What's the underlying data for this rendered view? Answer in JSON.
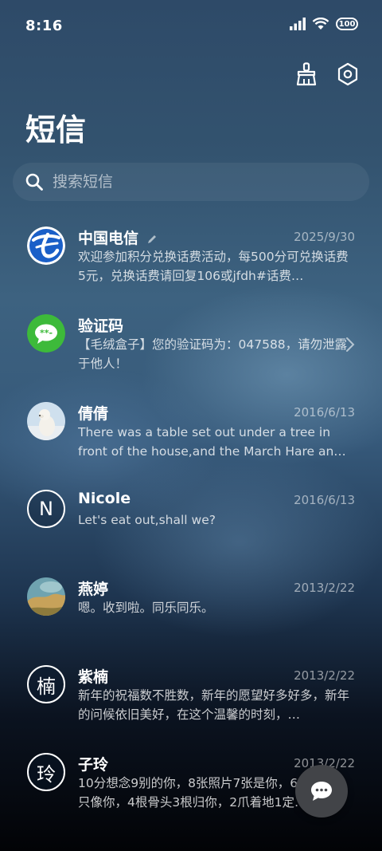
{
  "status_bar": {
    "time": "8:16",
    "battery": "100"
  },
  "header": {
    "title": "短信"
  },
  "search": {
    "placeholder": "搜索短信"
  },
  "conversations": [
    {
      "name": "中国电信",
      "date": "2025/9/30",
      "preview": "欢迎参加积分兑换话费活动，每500分可兑换话费5元，兑换话费请回复106或jfdh#话费…",
      "avatar": "china-telecom-logo"
    },
    {
      "name": "验证码",
      "date": "",
      "preview": "【毛绒盒子】您的验证码为：047588，请勿泄露于他人！",
      "avatar": "message-bubble-icon"
    },
    {
      "name": "倩倩",
      "date": "2016/6/13",
      "preview": "There was a table set out under a tree in front of the house,and the March Hare an…",
      "avatar": "polar-bear-photo"
    },
    {
      "name": "Nicole",
      "date": "2016/6/13",
      "preview": "Let's eat out,shall we?",
      "avatar_letter": "N"
    },
    {
      "name": "燕婷",
      "date": "2013/2/22",
      "preview": "嗯。收到啦。同乐同乐。",
      "avatar": "landscape-photo"
    },
    {
      "name": "紫楠",
      "date": "2013/2/22",
      "preview": "新年的祝福数不胜数，新年的愿望好多好多，新年的问候依旧美好，在这个温馨的时刻，…",
      "avatar_letter": "楠"
    },
    {
      "name": "子玲",
      "date": "2013/2/22",
      "preview": "10分想念9别的你，8张照片7张是你，6只小狗5只像你，4根骨头3根归你，2爪着地1定…",
      "avatar_letter": "玲"
    }
  ],
  "colors": {
    "telecom_blue": "#1a5fc8",
    "verify_green": "#3dba3a",
    "fab_bg": "#424448"
  }
}
